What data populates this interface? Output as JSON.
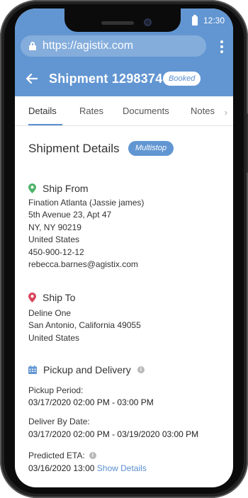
{
  "status_bar": {
    "time": "12:30"
  },
  "browser": {
    "url": "https://agistix.com"
  },
  "header": {
    "title": "Shipment 1298374",
    "status_badge": "Booked"
  },
  "tabs": [
    {
      "label": "Details",
      "active": true
    },
    {
      "label": "Rates",
      "active": false
    },
    {
      "label": "Documents",
      "active": false
    },
    {
      "label": "Notes",
      "active": false
    }
  ],
  "main": {
    "section_title": "Shipment Details",
    "section_badge": "Multistop",
    "ship_from": {
      "heading": "Ship From",
      "lines": [
        "Fination Atlanta (Jassie james)",
        "5th Avenue 23, Apt 47",
        "NY,  NY 90219",
        "United States",
        "450-900-12-12",
        "rebecca.barnes@agistix.com"
      ]
    },
    "ship_to": {
      "heading": "Ship To",
      "lines": [
        "Deline One",
        "San Antonio, California 49055",
        "United States"
      ]
    },
    "pickup_delivery": {
      "heading": "Pickup and Delivery",
      "pickup_label": "Pickup Period:",
      "pickup_value": "03/17/2020 02:00 PM - 03:00 PM",
      "deliver_label": "Deliver By Date:",
      "deliver_value": "03/17/2020 02:00 PM - 03/19/2020 03:00 PM",
      "eta_label": "Predicted ETA:",
      "eta_value": "03/16/2020 13:00",
      "eta_link": "Show Details"
    }
  },
  "colors": {
    "brand": "#6296d2",
    "link": "#5b8fd0",
    "ship_from_pin": "#4fb36a",
    "ship_to_pin": "#d9465d",
    "calendar": "#6296d2"
  }
}
